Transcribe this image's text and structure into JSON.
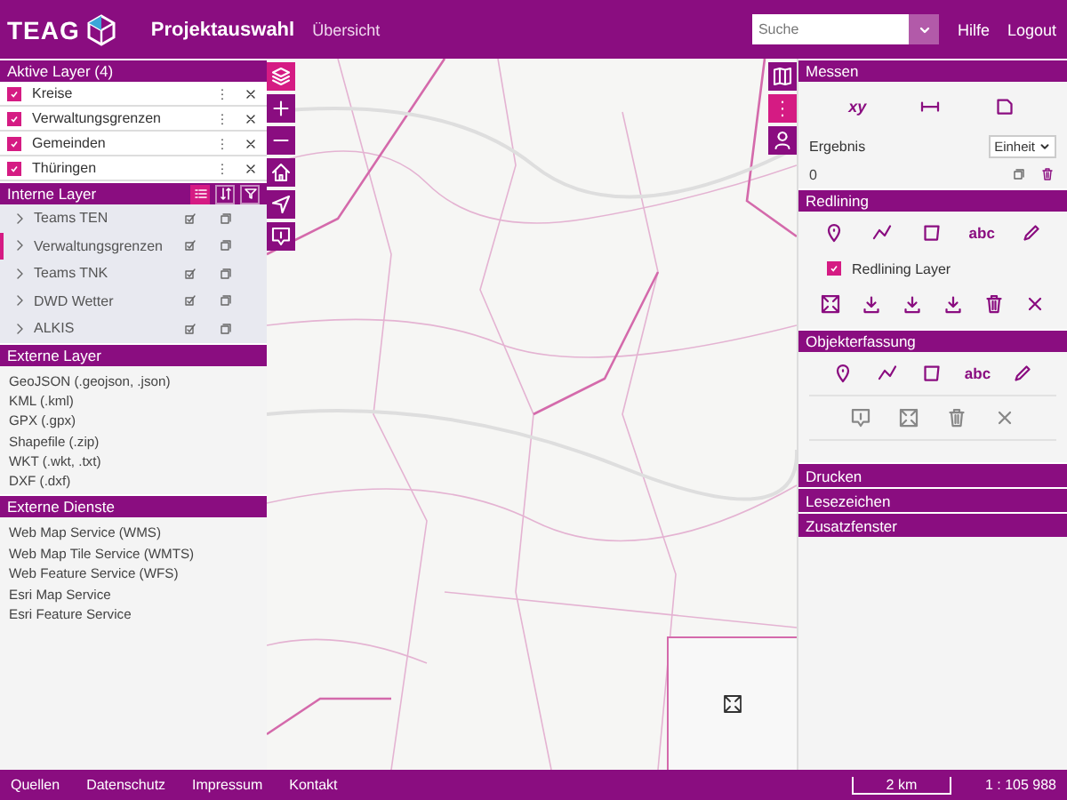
{
  "header": {
    "logo": "TEAG",
    "title": "Projektauswahl",
    "nav": "Übersicht",
    "search": {
      "placeholder": "Suche"
    },
    "links": [
      "Hilfe",
      "Logout"
    ]
  },
  "active_layers": {
    "title": "Aktive Layer (4)",
    "items": [
      {
        "label": "Kreise",
        "checked": true
      },
      {
        "label": "Verwaltungsgrenzen",
        "checked": true
      },
      {
        "label": "Gemeinden",
        "checked": true
      },
      {
        "label": "Thüringen",
        "checked": true
      }
    ]
  },
  "internal_layers": {
    "title": "Interne Layer",
    "tools": [
      {
        "kind": "list",
        "selected": true
      },
      {
        "kind": "sort",
        "selected": false
      },
      {
        "kind": "filter",
        "selected": false
      }
    ],
    "items": [
      {
        "label": "Teams TEN",
        "selected": false
      },
      {
        "label": "Verwaltungsgrenzen",
        "selected": true
      },
      {
        "label": "Teams TNK",
        "selected": false
      },
      {
        "label": "DWD Wetter",
        "selected": false
      },
      {
        "label": "ALKIS",
        "selected": false
      }
    ]
  },
  "external_layers": {
    "title": "Externe Layer",
    "items": [
      "GeoJSON (.geojson, .json)",
      "KML (.kml)",
      "GPX (.gpx)",
      "Shapefile (.zip)",
      "WKT (.wkt, .txt)",
      "DXF (.dxf)"
    ]
  },
  "external_services": {
    "title": "Externe Dienste",
    "items": [
      "Web Map Service (WMS)",
      "Web Map Tile Service (WMTS)",
      "Web Feature Service (WFS)",
      "Esri Map Service",
      "Esri Feature Service"
    ]
  },
  "map_tools_left": [
    {
      "kind": "layers",
      "selected": true
    },
    {
      "kind": "zoom_in",
      "selected": false
    },
    {
      "kind": "zoom_out",
      "selected": false
    },
    {
      "kind": "home",
      "selected": false
    },
    {
      "kind": "locate",
      "selected": false
    },
    {
      "kind": "info",
      "selected": false
    }
  ],
  "map_tools_right": [
    {
      "kind": "map",
      "selected": false
    },
    {
      "kind": "more",
      "selected": true
    },
    {
      "kind": "user",
      "selected": false
    }
  ],
  "measure": {
    "title": "Messen",
    "tools": [
      {
        "kind": "coordinate",
        "label": "xy"
      },
      {
        "kind": "distance"
      },
      {
        "kind": "area"
      }
    ],
    "result_label": "Ergebnis",
    "unit": "Einheit",
    "value": "0"
  },
  "redlining": {
    "title": "Redlining",
    "tools": [
      {
        "kind": "point"
      },
      {
        "kind": "line"
      },
      {
        "kind": "polygon"
      },
      {
        "kind": "text",
        "label": "abc"
      },
      {
        "kind": "freehand"
      }
    ],
    "layer": {
      "label": "Redlining Layer",
      "checked": true
    },
    "actions": [
      {
        "kind": "extent",
        "disabled": false
      },
      {
        "kind": "download",
        "disabled": false
      },
      {
        "kind": "download",
        "disabled": false
      },
      {
        "kind": "download",
        "disabled": false
      },
      {
        "kind": "delete",
        "disabled": false
      },
      {
        "kind": "close",
        "disabled": false
      }
    ]
  },
  "feature_capture": {
    "title": "Objekterfassung",
    "tools": [
      {
        "kind": "point"
      },
      {
        "kind": "line"
      },
      {
        "kind": "polygon"
      },
      {
        "kind": "text",
        "label": "abc"
      },
      {
        "kind": "freehand"
      }
    ],
    "actions": [
      {
        "kind": "info",
        "disabled": true
      },
      {
        "kind": "extent",
        "disabled": true
      },
      {
        "kind": "delete",
        "disabled": true
      },
      {
        "kind": "close",
        "disabled": true
      }
    ]
  },
  "collapsed_sections": [
    "Drucken",
    "Lesezeichen",
    "Zusatzfenster"
  ],
  "footer": {
    "links": [
      "Quellen",
      "Datenschutz",
      "Impressum",
      "Kontakt"
    ],
    "scale": "2 km",
    "ratio": "1 : 105 988"
  }
}
